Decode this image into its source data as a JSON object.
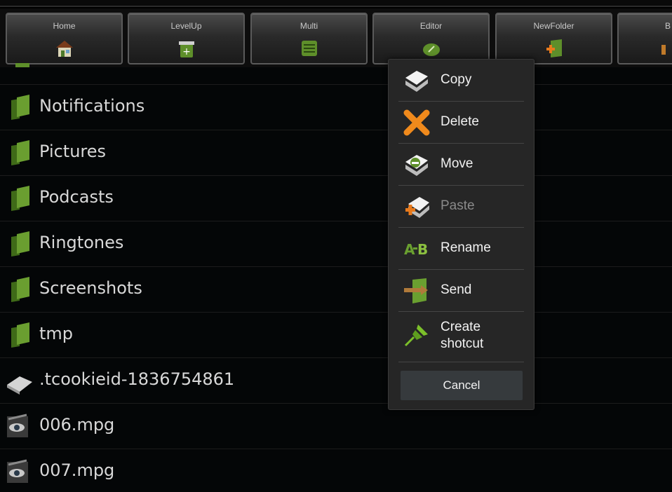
{
  "toolbar": {
    "buttons": [
      {
        "label": "Home",
        "icon": "home-icon"
      },
      {
        "label": "LevelUp",
        "icon": "level-up-icon"
      },
      {
        "label": "Multi",
        "icon": "multi-select-icon"
      },
      {
        "label": "Editor",
        "icon": "editor-icon"
      },
      {
        "label": "NewFolder",
        "icon": "new-folder-icon"
      },
      {
        "label": "B",
        "icon": "bookmark-icon"
      }
    ]
  },
  "file_list": {
    "items": [
      {
        "name": "Notifications",
        "type": "folder"
      },
      {
        "name": "Pictures",
        "type": "folder"
      },
      {
        "name": "Podcasts",
        "type": "folder"
      },
      {
        "name": "Ringtones",
        "type": "folder"
      },
      {
        "name": "Screenshots",
        "type": "folder"
      },
      {
        "name": "tmp",
        "type": "folder"
      },
      {
        "name": ".tcookieid-1836754861",
        "type": "file"
      },
      {
        "name": "006.mpg",
        "type": "video"
      },
      {
        "name": "007.mpg",
        "type": "video"
      }
    ]
  },
  "context_menu": {
    "items": [
      {
        "label": "Copy",
        "icon": "copy-icon",
        "enabled": true
      },
      {
        "label": "Delete",
        "icon": "delete-icon",
        "enabled": true
      },
      {
        "label": "Move",
        "icon": "move-icon",
        "enabled": true
      },
      {
        "label": "Paste",
        "icon": "paste-icon",
        "enabled": false
      },
      {
        "label": "Rename",
        "icon": "rename-icon",
        "enabled": true
      },
      {
        "label": "Send",
        "icon": "send-icon",
        "enabled": true
      },
      {
        "label": "Create shotcut",
        "icon": "pin-icon",
        "enabled": true
      }
    ],
    "cancel_label": "Cancel"
  },
  "colors": {
    "background": "#040607",
    "folder_green": "#5e8f2a",
    "menu_bg": "#262626",
    "delete_orange": "#f08a1c"
  }
}
